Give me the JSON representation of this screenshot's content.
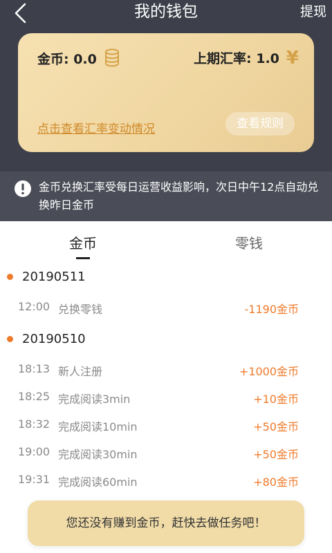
{
  "header": {
    "title": "我的钱包",
    "withdraw_label": "提现"
  },
  "card": {
    "coin_label": "金币: 0.0",
    "rate_label": "上期汇率: 1.0",
    "yen_symbol": "¥",
    "rate_link": "点击查看汇率变动情况",
    "rule_button": "查看规则"
  },
  "notice": {
    "text": "金币兑换汇率受每日运营收益影响，次日中午12点自动兑换昨日金币"
  },
  "tabs": [
    {
      "label": "金币"
    },
    {
      "label": "零钱"
    }
  ],
  "records": [
    {
      "date": "20190511",
      "items": [
        {
          "time": "12:00",
          "desc": "兑换零钱",
          "amount": "-1190金币"
        }
      ]
    },
    {
      "date": "20190510",
      "items": [
        {
          "time": "18:13",
          "desc": "新人注册",
          "amount": "+1000金币"
        },
        {
          "time": "18:25",
          "desc": "完成阅读3min",
          "amount": "+10金币"
        },
        {
          "time": "18:32",
          "desc": "完成阅读10min",
          "amount": "+50金币"
        },
        {
          "time": "19:00",
          "desc": "完成阅读30min",
          "amount": "+50金币"
        },
        {
          "time": "19:31",
          "desc": "完成阅读60min",
          "amount": "+80金币"
        }
      ]
    }
  ],
  "toast": {
    "text": "您还没有赚到金币，赶快去做任务吧！"
  },
  "colors": {
    "accent": "#ef7a2a",
    "header_bg": "#3d404a",
    "card_gold": "#f0d7a2"
  }
}
